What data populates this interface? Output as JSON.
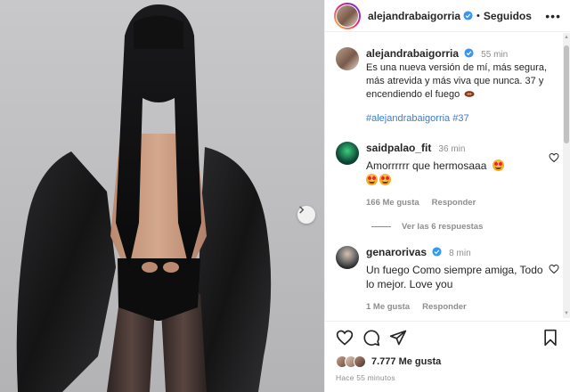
{
  "post": {
    "username": "alejandrabaigorria",
    "follow_status": "Seguidos",
    "separator": "•",
    "more_label": "•••"
  },
  "caption": {
    "username": "alejandrabaigorria",
    "time": "55 min",
    "text": "Es una nueva versión de mí, más segura, más atrevida y más viva que nunca. 37 y encendiendo el fuego",
    "emoji": "football",
    "hashtags": "#alejandrabaigorria #37"
  },
  "comments": [
    {
      "username": "saidpalao_fit",
      "time": "36 min",
      "text": "Amorrrrrr que hermosaaa",
      "emoji": "heart-eyes",
      "likes": "166 Me gusta",
      "reply": "Responder",
      "view_replies": "Ver las 6 respuestas"
    },
    {
      "username": "genarorivas",
      "time": "8 min",
      "text": "Un fuego Como siempre amiga, Todo lo mejor. Love you",
      "likes": "1 Me gusta",
      "reply": "Responder"
    }
  ],
  "engagement": {
    "likes_count": "7.777 Me gusta",
    "posted_ago": "Hace 55 minutos"
  },
  "colors": {
    "verified": "#3897f0",
    "hashtag": "#3a7dd1",
    "muted": "#8e8e8e"
  }
}
